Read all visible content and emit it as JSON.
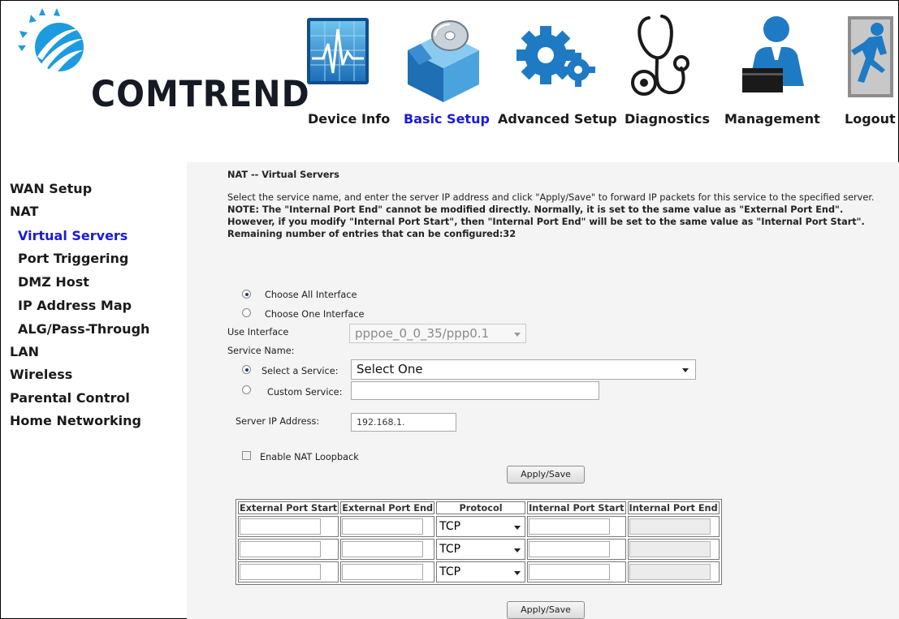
{
  "brand": {
    "name": "COMTREND"
  },
  "nav": [
    {
      "label": "Device Info",
      "icon": "device-info-icon"
    },
    {
      "label": "Basic Setup",
      "icon": "basic-setup-icon",
      "active": true
    },
    {
      "label": "Advanced Setup",
      "icon": "advanced-setup-icon"
    },
    {
      "label": "Diagnostics",
      "icon": "diagnostics-icon"
    },
    {
      "label": "Management",
      "icon": "management-icon"
    },
    {
      "label": "Logout",
      "icon": "logout-icon"
    }
  ],
  "sidebar": {
    "items": [
      {
        "label": "WAN Setup"
      },
      {
        "label": "NAT"
      },
      {
        "label": "Virtual Servers",
        "active": true
      },
      {
        "label": "Port Triggering"
      },
      {
        "label": "DMZ Host"
      },
      {
        "label": "IP Address Map"
      },
      {
        "label": "ALG/Pass-Through"
      },
      {
        "label": "LAN"
      },
      {
        "label": "Wireless"
      },
      {
        "label": "Parental Control"
      },
      {
        "label": "Home Networking"
      }
    ]
  },
  "page": {
    "title": "NAT -- Virtual Servers",
    "desc_plain": "Select the service name, and enter the server IP address and click \"Apply/Save\" to forward IP packets for this service to the specified server. ",
    "desc_note": "NOTE: The \"Internal Port End\" cannot be modified directly. Normally, it is set to the same value as \"External Port End\". However, if you modify \"Internal Port Start\", then \"Internal Port End\" will be set to the same value as \"Internal Port Start\".",
    "remaining": "Remaining number of entries that can be configured:32"
  },
  "form": {
    "choose_all": "Choose All Interface",
    "choose_one": "Choose One Interface",
    "use_interface_label": "Use Interface",
    "use_interface_value": "pppoe_0_0_35/ppp0.1",
    "service_name_label": "Service Name:",
    "select_service_label": "Select a Service:",
    "select_service_value": "Select One",
    "custom_service_label": "Custom Service:",
    "custom_service_value": "",
    "server_ip_label": "Server IP Address:",
    "server_ip_value": "192.168.1.",
    "nat_loopback_label": "Enable NAT Loopback",
    "apply_label": "Apply/Save"
  },
  "table": {
    "headers": [
      "External Port Start",
      "External Port End",
      "Protocol",
      "Internal Port Start",
      "Internal Port End"
    ],
    "rows": [
      {
        "protocol": "TCP"
      },
      {
        "protocol": "TCP"
      },
      {
        "protocol": "TCP"
      }
    ]
  }
}
